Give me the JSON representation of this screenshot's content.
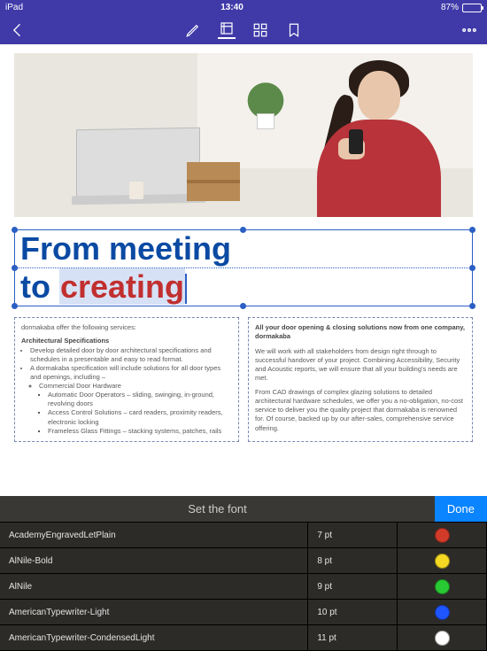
{
  "status": {
    "device": "iPad",
    "time": "13:40",
    "battery_pct": "87%"
  },
  "toolbar": {
    "back": "Back",
    "icons": [
      "pen-icon",
      "frame-icon",
      "grid-icon",
      "bookmark-icon",
      "more-icon"
    ]
  },
  "document": {
    "headline_line1": "From meeting",
    "headline_line2_prefix": "to ",
    "headline_line2_highlight": "creating",
    "left_col": {
      "intro": "dormakaba offer the following services:",
      "section_title": "Architectural Specifications",
      "bullets": [
        "Develop detailed door by door architectural specifications and schedules in a presentable and easy to read format.",
        "A dormakaba specification will include solutions for all door types and openings, including –"
      ],
      "sub_bullets_title": "Commercial Door Hardware",
      "sub_bullets": [
        "Automatic Door Operators – sliding, swinging, in-ground, revolving doors",
        "Access Control Solutions – card readers, proximity readers, electronic locking",
        "Frameless Glass Fittings – stacking systems, patches, rails"
      ]
    },
    "right_col": {
      "lead": "All your door opening & closing solutions now from one company, dormakaba",
      "p1": "We will work with all stakeholders from design right through to successful handover of your project. Combining Accessibility, Security and Acoustic reports, we will ensure that all your building's needs are met.",
      "p2": "From CAD drawings of complex glazing solutions to detailed architectural hardware schedules, we offer you a no-obligation, no-cost service to deliver you the quality project that dormakaba is renowned for. Of course, backed up by our after-sales, comprehensive service offering."
    }
  },
  "panel": {
    "title": "Set the font",
    "done": "Done",
    "fonts": [
      "AcademyEngravedLetPlain",
      "AlNile-Bold",
      "AlNile",
      "AmericanTypewriter-Light",
      "AmericanTypewriter-CondensedLight"
    ],
    "sizes": [
      "7 pt",
      "8 pt",
      "9 pt",
      "10 pt",
      "11 pt"
    ],
    "colors": [
      "#d23b2a",
      "#f4d823",
      "#28c933",
      "#1e55ff",
      "#ffffff"
    ]
  }
}
